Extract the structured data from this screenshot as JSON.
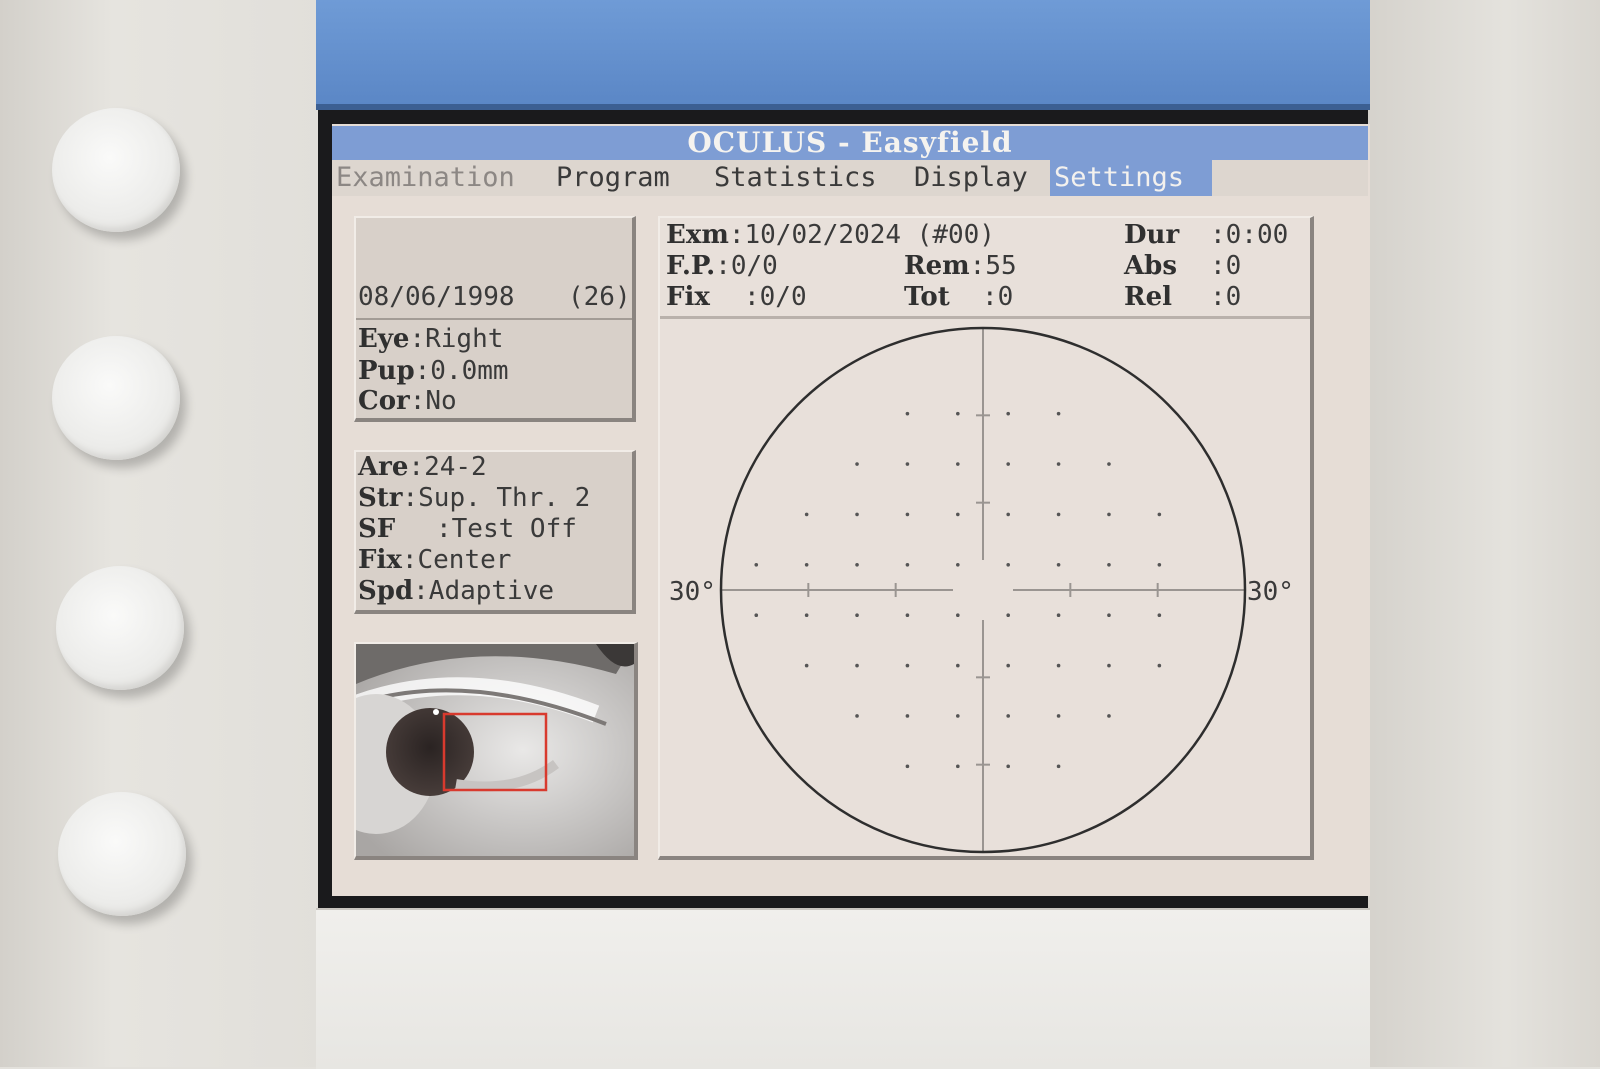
{
  "app": {
    "title": "OCULUS - Easyfield"
  },
  "menu": [
    {
      "label": "Examination",
      "state": "disabled"
    },
    {
      "label": "Program",
      "state": "normal"
    },
    {
      "label": "Statistics",
      "state": "normal"
    },
    {
      "label": "Display",
      "state": "normal"
    },
    {
      "label": "Settings",
      "state": "selected"
    }
  ],
  "patient": {
    "birth_date": "08/06/1998",
    "age": "(26)",
    "eye": {
      "label": "Eye",
      "value": ":Right"
    },
    "pupil": {
      "label": "Pup",
      "value": ":0.0mm"
    },
    "correction": {
      "label": "Cor",
      "value": ":No"
    }
  },
  "program": {
    "area": {
      "label": "Are",
      "value": ":24-2"
    },
    "strategy": {
      "label": "Str",
      "value": ":Sup. Thr. 2"
    },
    "sf": {
      "label": "SF",
      "value": ":Test Off"
    },
    "fixation": {
      "label": "Fix",
      "value": ":Center"
    },
    "speed": {
      "label": "Spd",
      "value": ":Adaptive"
    }
  },
  "exam": {
    "exm": {
      "label": "Exm",
      "value": ":10/02/2024 (#00)"
    },
    "fp": {
      "label": "F.P.",
      "value": ":0/0"
    },
    "fix": {
      "label": "Fix",
      "value": ":0/0"
    },
    "rem": {
      "label": "Rem",
      "value": ":55"
    },
    "tot": {
      "label": "Tot",
      "value": ":0"
    },
    "dur": {
      "label": "Dur",
      "value": ":0:00"
    },
    "abs": {
      "label": "Abs",
      "value": ":0"
    },
    "rel": {
      "label": "Rel",
      "value": ":0"
    }
  },
  "field": {
    "left_label": "30°",
    "right_label": "30°",
    "pattern": "24-2",
    "colors": {
      "grid": "#9a9591",
      "circle": "#2e2e2e",
      "dot": "#555"
    }
  },
  "camera": {
    "overlay_color": "#d83a2e"
  }
}
